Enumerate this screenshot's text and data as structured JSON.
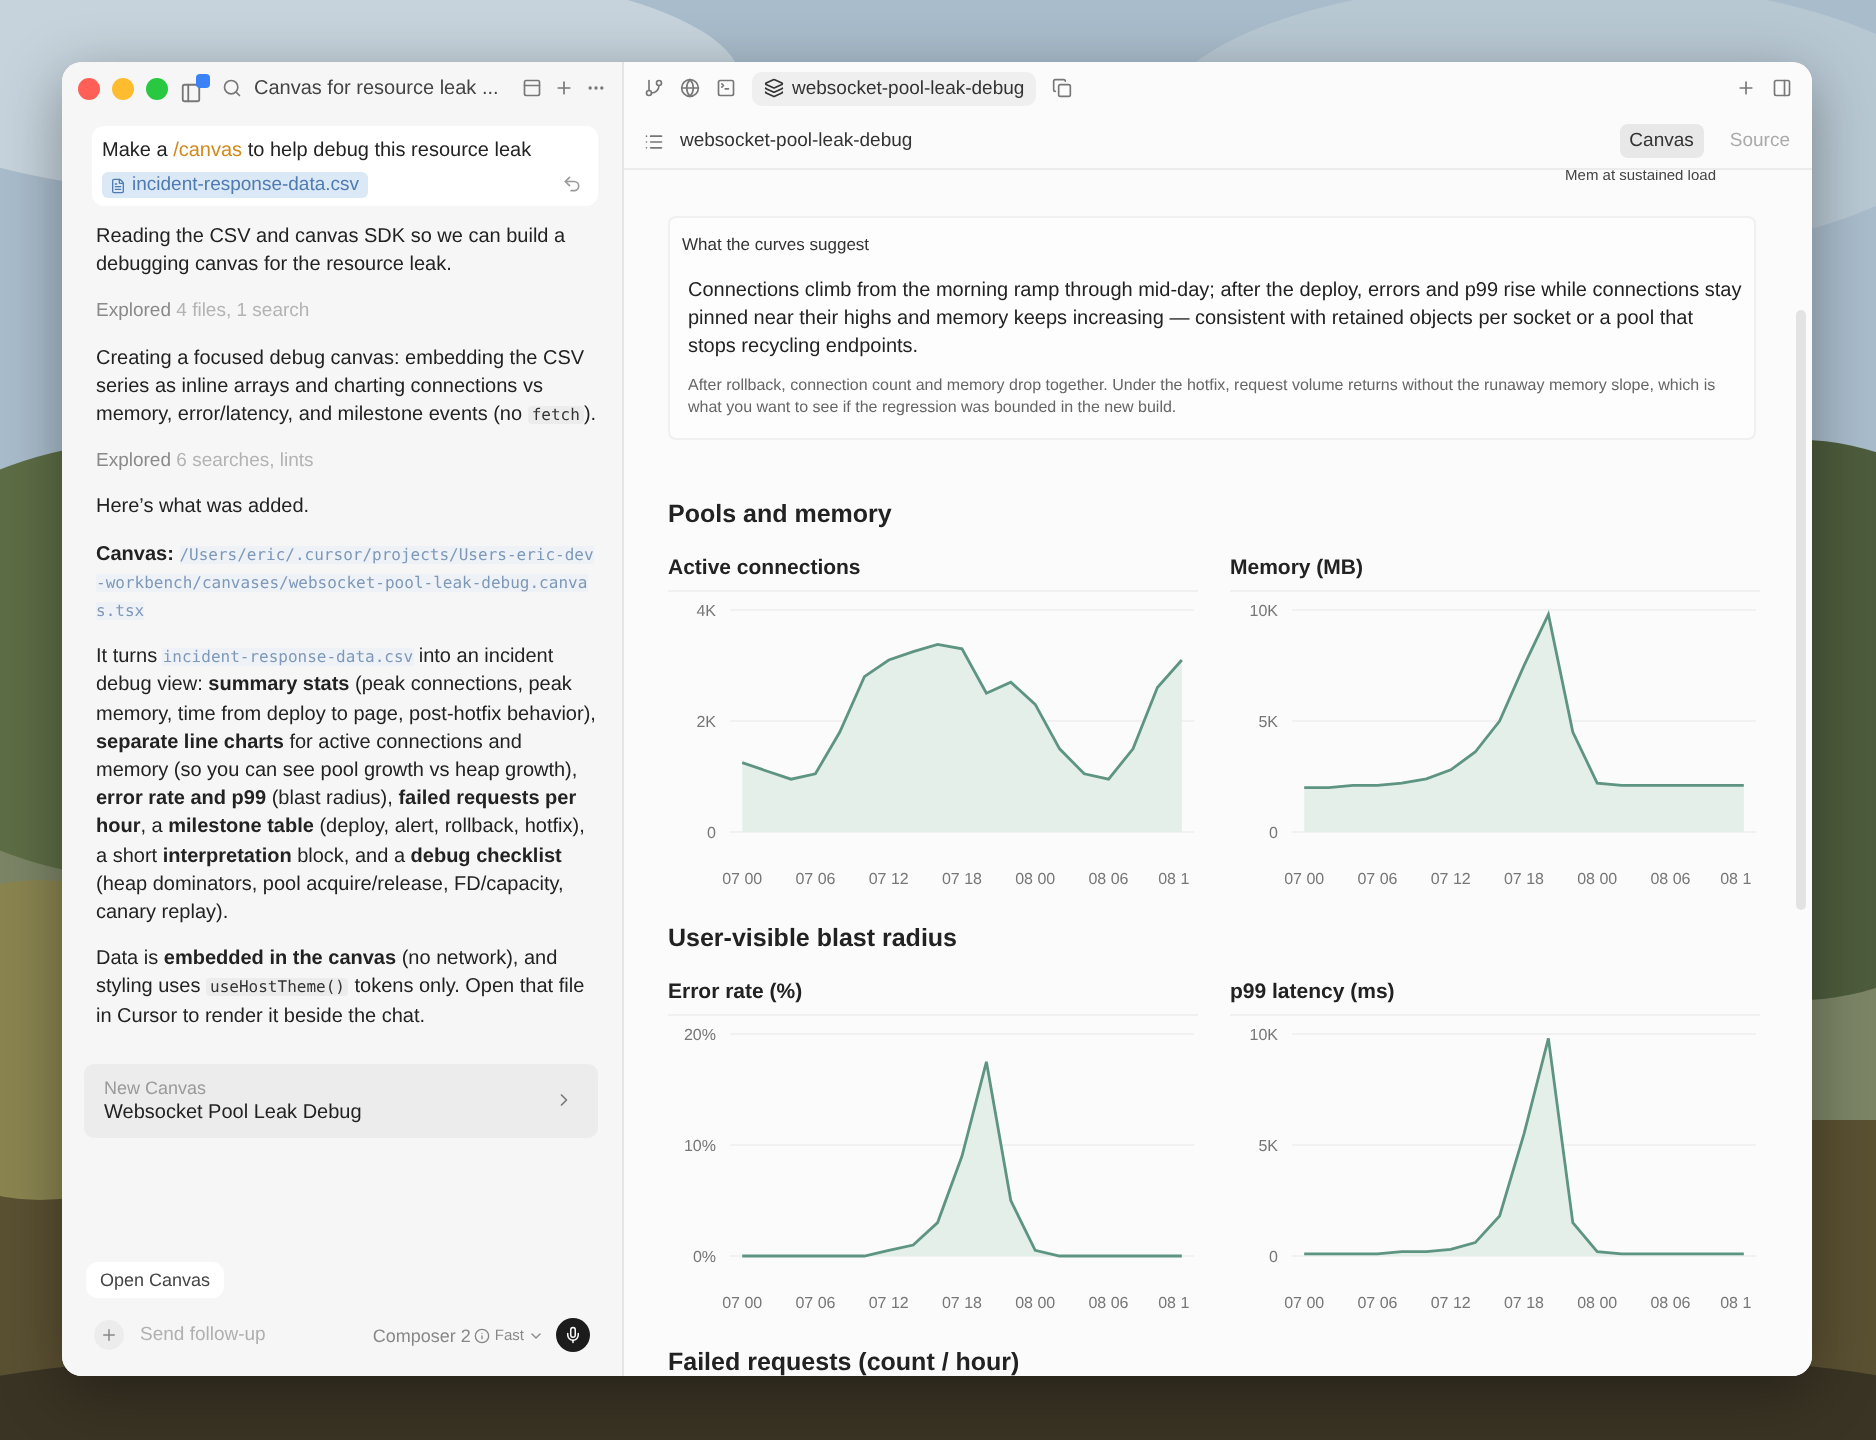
{
  "window": {
    "title": "Canvas for resource leak ..."
  },
  "chat": {
    "prompt": [
      {
        "kind": "text",
        "text": "Make a "
      },
      {
        "kind": "command",
        "text": "/canvas"
      },
      {
        "kind": "text",
        "text": " to help debug this resource leak"
      }
    ],
    "attachment": "incident-response-data.csv",
    "messages": [
      {
        "kind": "body",
        "parts": [
          {
            "kind": "text",
            "text": "Reading the CSV and canvas SDK so we can build a debugging canvas for the resource leak."
          }
        ]
      },
      {
        "kind": "status",
        "parts": [
          {
            "kind": "text",
            "text": "Explored "
          },
          {
            "kind": "muted",
            "text": "4 files, 1 search"
          }
        ]
      },
      {
        "kind": "body",
        "parts": [
          {
            "kind": "text",
            "text": "Creating a focused debug canvas: embedding the CSV series as inline arrays and charting connections vs memory, error/latency, and milestone events (no "
          },
          {
            "kind": "code",
            "text": "fetch"
          },
          {
            "kind": "text",
            "text": ")."
          }
        ]
      },
      {
        "kind": "status",
        "parts": [
          {
            "kind": "text",
            "text": "Explored "
          },
          {
            "kind": "muted",
            "text": "6 searches, lints"
          }
        ]
      },
      {
        "kind": "body",
        "parts": [
          {
            "kind": "text",
            "text": "Here’s what was added."
          }
        ]
      },
      {
        "kind": "body",
        "parts": [
          {
            "kind": "text",
            "text": "**Canvas:** "
          },
          {
            "kind": "path",
            "text": "/Users/eric/.cursor/projects/Users-eric-dev-workbench/canvases/websocket-pool-leak-debug.canvas.tsx"
          }
        ]
      },
      {
        "kind": "body",
        "parts": [
          {
            "kind": "text",
            "text": "It turns "
          },
          {
            "kind": "path",
            "text": "incident-response-data.csv"
          },
          {
            "kind": "text",
            "text": " into an incident debug view: **summary stats** (peak connections, peak memory, time from deploy to page, post-hotfix behavior), **separate line charts** for active connections and memory (so you can see pool growth vs heap growth), **error rate and p99** (blast radius), **failed requests per hour**, a **milestone table** (deploy, alert, rollback, hotfix), a short **interpretation** block, and a **debug checklist** (heap dominators, pool acquire/release, FD/capacity, canary replay)."
          }
        ]
      },
      {
        "kind": "body",
        "parts": [
          {
            "kind": "text",
            "text": "Data is **embedded in the canvas** (no network), and styling uses "
          },
          {
            "kind": "code",
            "text": "useHostTheme()"
          },
          {
            "kind": "text",
            "text": " tokens only. Open that file in Cursor to render it beside the chat."
          }
        ]
      }
    ],
    "canvas_card": {
      "label": "New Canvas",
      "title": "Websocket Pool Leak Debug"
    },
    "open_canvas": "Open Canvas",
    "composer": {
      "placeholder": "Send follow-up",
      "model": "Composer 2",
      "mode": "Fast"
    }
  },
  "editor": {
    "tab": "websocket-pool-leak-debug",
    "breadcrumb": "websocket-pool-leak-debug",
    "views": [
      {
        "label": "Canvas",
        "selected": true
      },
      {
        "label": "Source",
        "selected": false
      }
    ],
    "clipped_caption": "Mem at sustained load",
    "insight": {
      "title": "What the curves suggest",
      "lead": "Connections climb from the morning ramp through mid-day; after the deploy, errors and p99 rise while connections stay pinned near their highs and memory keeps increasing — consistent with retained objects per socket or a pool that stops recycling endpoints.",
      "detail": "After rollback, connection count and memory drop together. Under the hotfix, request volume returns without the runaway memory slope, which is what you want to see if the regression was bounded in the new build."
    },
    "sections": [
      {
        "title": "Pools and memory",
        "charts": [
          {
            "title": "Active connections",
            "chart_data": {
              "type": "area",
              "categories": [
                "07 00",
                null,
                null,
                "07 06",
                null,
                null,
                "07 12",
                null,
                null,
                "07 18",
                null,
                null,
                "08 00",
                null,
                null,
                "08 06",
                null,
                null,
                "08 1"
              ],
              "values": [
                1250,
                1100,
                950,
                1050,
                1800,
                2800,
                3100,
                3250,
                3380,
                3300,
                2500,
                2700,
                2300,
                1500,
                1050,
                950,
                1500,
                2600,
                3100
              ],
              "ylim": [
                0,
                4000
              ],
              "yticks": [
                {
                  "value": 0,
                  "label": "0"
                },
                {
                  "value": 2000,
                  "label": "2K"
                },
                {
                  "value": 4000,
                  "label": "4K"
                }
              ]
            }
          },
          {
            "title": "Memory (MB)",
            "chart_data": {
              "type": "area",
              "categories": [
                "07 00",
                null,
                null,
                "07 06",
                null,
                null,
                "07 12",
                null,
                null,
                "07 18",
                null,
                null,
                "08 00",
                null,
                null,
                "08 06",
                null,
                null,
                "08 1"
              ],
              "values": [
                2000,
                2000,
                2100,
                2100,
                2200,
                2400,
                2800,
                3600,
                5000,
                7500,
                9800,
                4500,
                2200,
                2100,
                2100,
                2100,
                2100,
                2100,
                2100
              ],
              "ylim": [
                0,
                10000
              ],
              "yticks": [
                {
                  "value": 0,
                  "label": "0"
                },
                {
                  "value": 5000,
                  "label": "5K"
                },
                {
                  "value": 10000,
                  "label": "10K"
                }
              ]
            }
          }
        ]
      },
      {
        "title": "User-visible blast radius",
        "charts": [
          {
            "title": "Error rate (%)",
            "chart_data": {
              "type": "area",
              "categories": [
                "07 00",
                null,
                null,
                "07 06",
                null,
                null,
                "07 12",
                null,
                null,
                "07 18",
                null,
                null,
                "08 00",
                null,
                null,
                "08 06",
                null,
                null,
                "08 1"
              ],
              "values": [
                0,
                0,
                0,
                0,
                0,
                0,
                0.5,
                1,
                3,
                9,
                17.5,
                5,
                0.5,
                0,
                0,
                0,
                0,
                0,
                0
              ],
              "ylim": [
                0,
                20
              ],
              "yticks": [
                {
                  "value": 0,
                  "label": "0%"
                },
                {
                  "value": 10,
                  "label": "10%"
                },
                {
                  "value": 20,
                  "label": "20%"
                }
              ]
            }
          },
          {
            "title": "p99 latency (ms)",
            "chart_data": {
              "type": "area",
              "categories": [
                "07 00",
                null,
                null,
                "07 06",
                null,
                null,
                "07 12",
                null,
                null,
                "07 18",
                null,
                null,
                "08 00",
                null,
                null,
                "08 06",
                null,
                null,
                "08 1"
              ],
              "values": [
                100,
                100,
                100,
                100,
                200,
                200,
                300,
                600,
                1800,
                5500,
                9800,
                1500,
                200,
                100,
                100,
                100,
                100,
                100,
                100
              ],
              "ylim": [
                0,
                10000
              ],
              "yticks": [
                {
                  "value": 0,
                  "label": "0"
                },
                {
                  "value": 5000,
                  "label": "5K"
                },
                {
                  "value": 10000,
                  "label": "10K"
                }
              ]
            }
          }
        ]
      }
    ],
    "next_section": "Failed requests (count / hour)"
  }
}
